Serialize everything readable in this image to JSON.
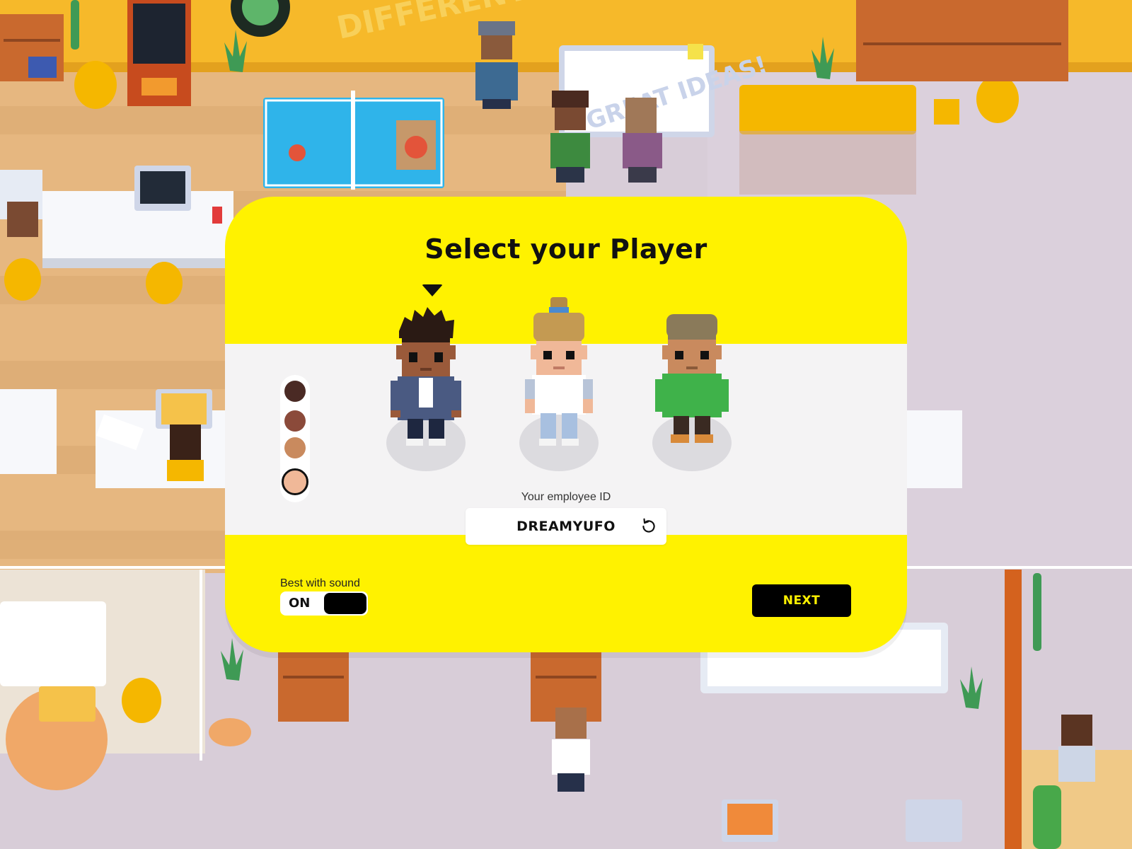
{
  "modal": {
    "title": "Select your Player",
    "employee_id_label": "Your employee ID",
    "employee_id_value": "DREAMYUFO",
    "sound_label": "Best with sound",
    "sound_state": "ON",
    "next_label": "NEXT",
    "accent_color": "#fff200",
    "band_color": "#f4f3f4"
  },
  "characters": [
    {
      "name": "character-1",
      "selected": true
    },
    {
      "name": "character-2",
      "selected": false
    },
    {
      "name": "character-3",
      "selected": false
    }
  ],
  "skin_tones": [
    {
      "color": "#4a2a24",
      "selected": false
    },
    {
      "color": "#8b4a3a",
      "selected": false
    },
    {
      "color": "#c98a5e",
      "selected": false
    },
    {
      "color": "#f0b898",
      "selected": true
    }
  ],
  "background": {
    "wall_sign_text": "DIFFERENT",
    "whiteboard_text": "GREAT IDEAS!"
  }
}
